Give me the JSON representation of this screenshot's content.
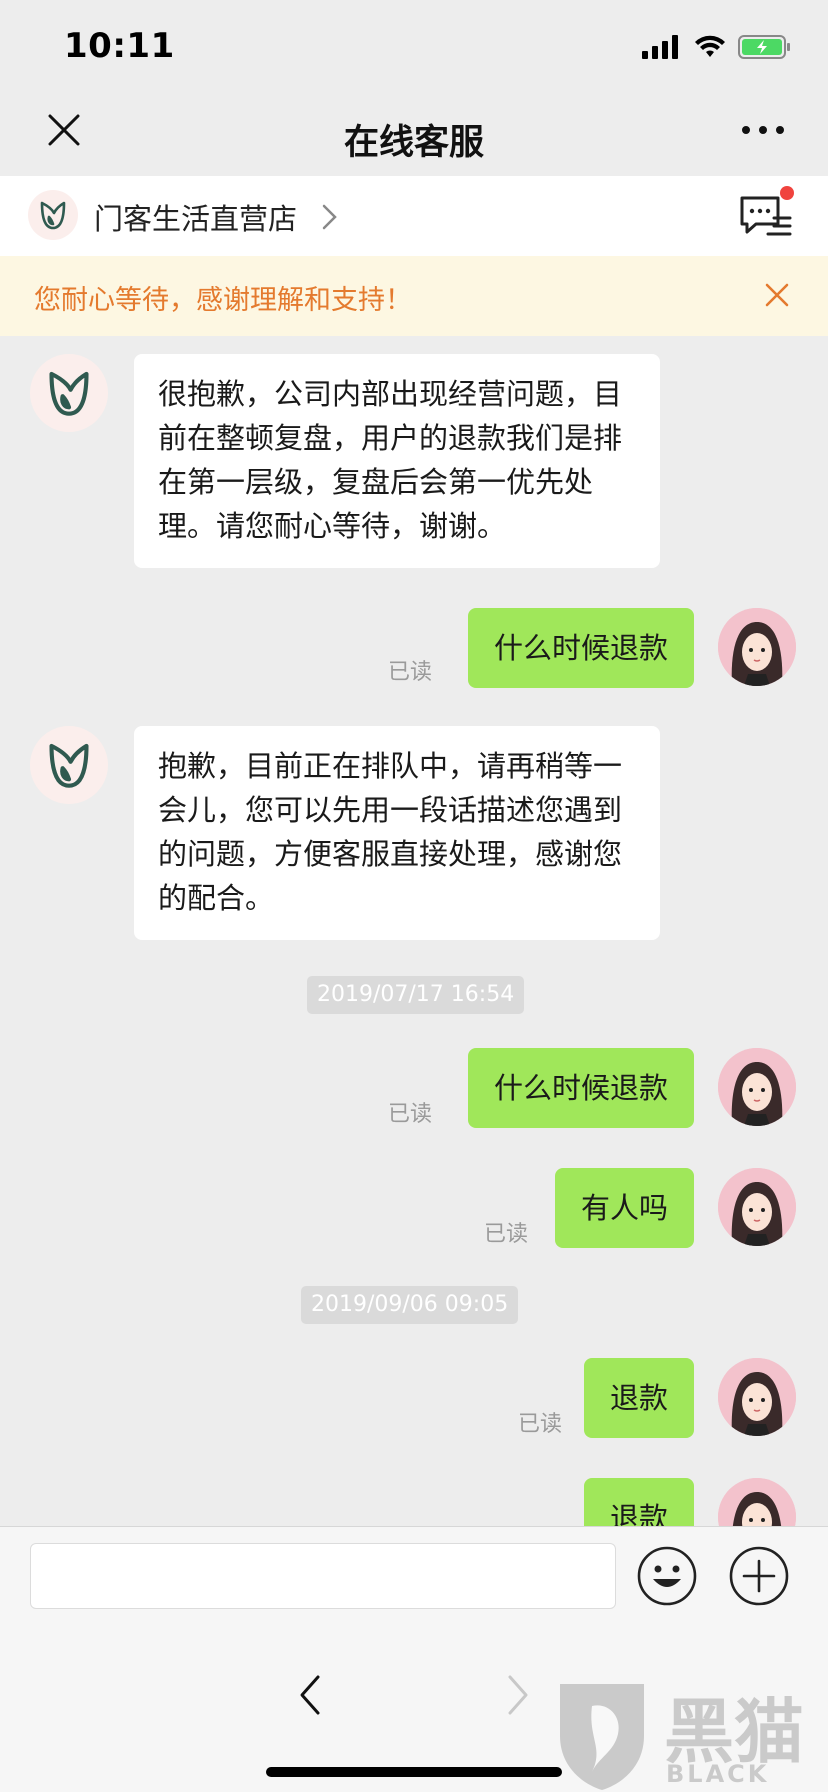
{
  "status": {
    "time": "10:11"
  },
  "nav": {
    "title": "在线客服"
  },
  "shop": {
    "name": "门客生活直营店"
  },
  "notice": {
    "text": "您耐心等待，感谢理解和支持！"
  },
  "messages": [
    {
      "side": "left",
      "text": "很抱歉，公司内部出现经营问题，目前在整顿复盘，用户的退款我们是排在第一层级，复盘后会第一优先处理。请您耐心等待，谢谢。"
    },
    {
      "side": "right",
      "text": "什么时候退款",
      "status": "已读"
    },
    {
      "side": "left",
      "text": "抱歉，目前正在排队中，请再稍等一会儿，您可以先用一段话描述您遇到的问题，方便客服直接处理，感谢您的配合。"
    },
    {
      "type": "time",
      "text": "2019/07/17 16:54"
    },
    {
      "side": "right",
      "text": "什么时候退款",
      "status": "已读"
    },
    {
      "side": "right",
      "text": "有人吗",
      "status": "已读"
    },
    {
      "type": "time",
      "text": "2019/09/06 09:05"
    },
    {
      "side": "right",
      "text": "退款",
      "status": "已读"
    },
    {
      "side": "right",
      "text": "退款"
    }
  ],
  "input": {
    "placeholder": ""
  },
  "watermark": {
    "text": "黑猫",
    "sub": "BLACK CAT"
  },
  "colors": {
    "bubble_self": "#a0e75a",
    "notice_text": "#e47a2e",
    "shop_logo": "#2f5a50"
  },
  "icons": [
    "close-icon",
    "more-icon",
    "chevron-right-icon",
    "message-icon",
    "emoji-icon",
    "plus-icon",
    "back-arrow-icon",
    "forward-arrow-icon"
  ]
}
